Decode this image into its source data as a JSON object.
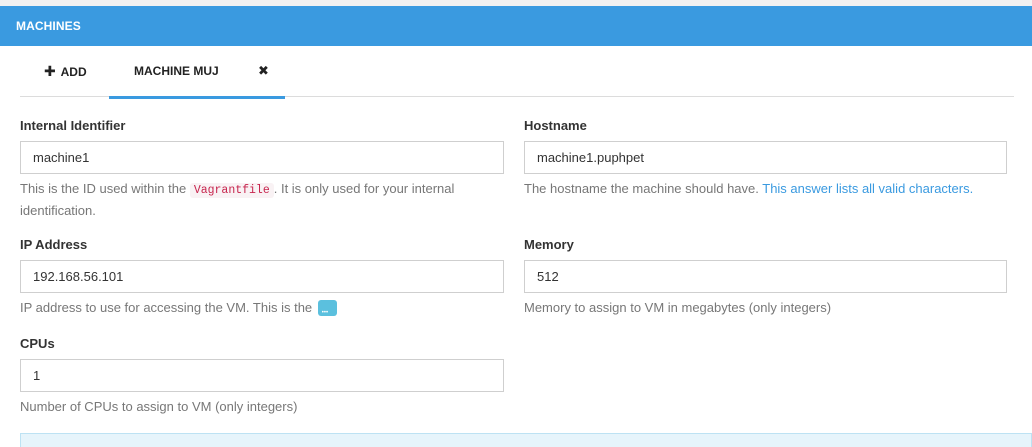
{
  "header": {
    "title": "MACHINES"
  },
  "tabs": {
    "add_label": "ADD",
    "active_label": "MACHINE MUJ"
  },
  "fields": {
    "internal_identifier": {
      "label": "Internal Identifier",
      "value": "machine1",
      "help_pre": "This is the ID used within the ",
      "help_code": "Vagrantfile",
      "help_post": ". It is only used for your internal",
      "help_line2": "identification."
    },
    "hostname": {
      "label": "Hostname",
      "value": "machine1.puphpet",
      "help_pre": "The hostname the machine should have. ",
      "help_link": "This answer lists all valid characters."
    },
    "ip_address": {
      "label": "IP Address",
      "value": "192.168.56.101",
      "help": "IP address to use for accessing the VM. This is the"
    },
    "memory": {
      "label": "Memory",
      "value": "512",
      "help": "Memory to assign to VM in megabytes (only integers)"
    },
    "cpus": {
      "label": "CPUs",
      "value": "1",
      "help": "Number of CPUs to assign to VM (only integers)"
    }
  },
  "colors": {
    "accent": "#3a9ae0",
    "code": "#c7254e",
    "info_bg": "#e6f4fb"
  }
}
